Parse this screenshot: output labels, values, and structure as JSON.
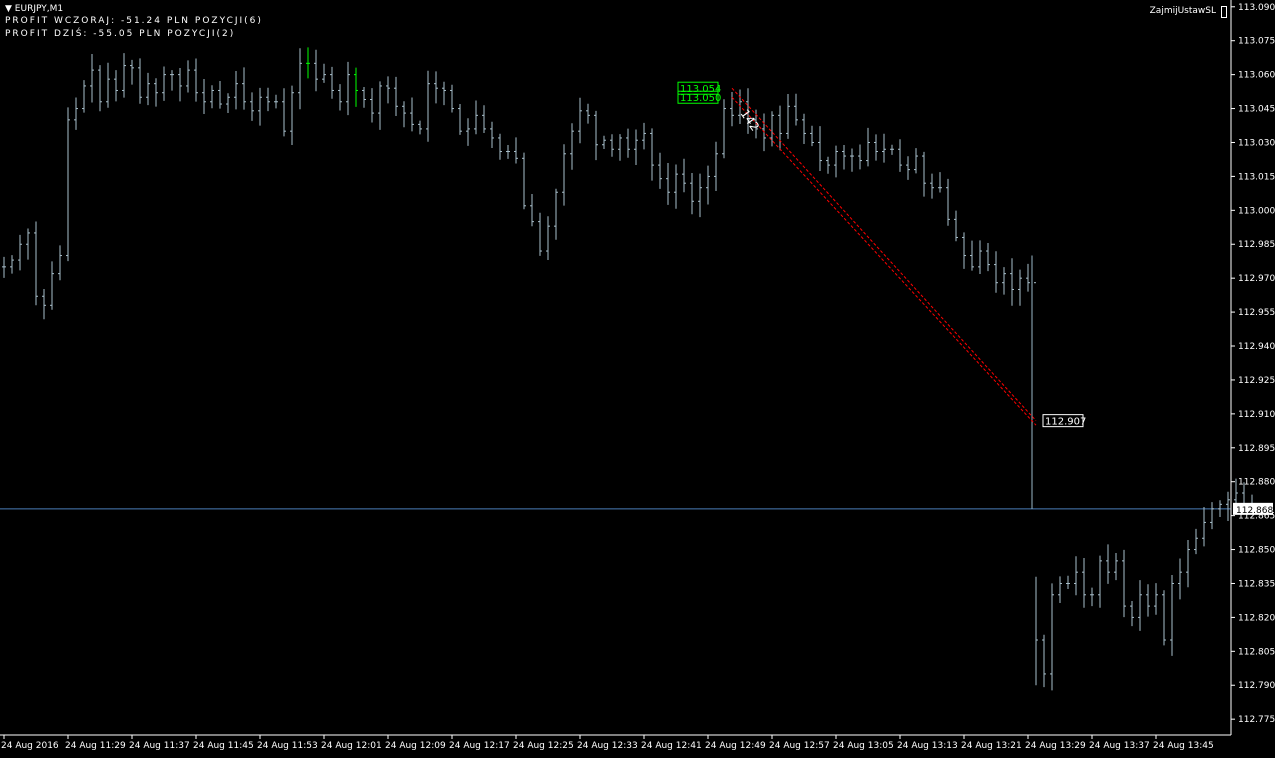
{
  "header": {
    "symbol": "EURJPY,M1",
    "line1": "PROFIT WCZORAJ: -51.24 PLN   POZYCJI(6)",
    "line2": "PROFIT DZIŚ: -55.05 PLN   POZYCJI(2)"
  },
  "expert": {
    "name": "ZajmijUstawSL"
  },
  "colors": {
    "background": "#000000",
    "bars": "#a9c0cc",
    "bull_highlight": "#00ff00",
    "axis": "#ffffff",
    "bid_line": "#4a7eb8",
    "trend_line": "#ff0000",
    "entry_label": "#00ff00",
    "drop_line": "#9ab8c8"
  },
  "chart_data": {
    "type": "ohlc",
    "symbol": "EURJPY",
    "timeframe": "M1",
    "ylim": [
      112.768,
      113.093
    ],
    "y_ticks": [
      "113.090",
      "113.075",
      "113.060",
      "113.045",
      "113.030",
      "113.015",
      "113.000",
      "112.985",
      "112.970",
      "112.955",
      "112.940",
      "112.925",
      "112.910",
      "112.895",
      "112.880",
      "112.865",
      "112.850",
      "112.835",
      "112.820",
      "112.805",
      "112.790",
      "112.775"
    ],
    "x_ticks": [
      "24 Aug 2016",
      "24 Aug 11:29",
      "24 Aug 11:37",
      "24 Aug 11:45",
      "24 Aug 11:53",
      "24 Aug 12:01",
      "24 Aug 12:09",
      "24 Aug 12:17",
      "24 Aug 12:25",
      "24 Aug 12:33",
      "24 Aug 12:41",
      "24 Aug 12:49",
      "24 Aug 12:57",
      "24 Aug 13:05",
      "24 Aug 13:13",
      "24 Aug 13:21",
      "24 Aug 13:29",
      "24 Aug 13:37",
      "24 Aug 13:45"
    ],
    "bars_per_tick": 8,
    "current_price": "112.868",
    "current_price_value": 112.868,
    "annotations": [
      {
        "type": "price_label",
        "text": "113.054",
        "value": 113.054,
        "bar": 90,
        "color": "#00ff00"
      },
      {
        "type": "price_label",
        "text": "113.050",
        "value": 113.05,
        "bar": 90,
        "color": "#00ff00"
      },
      {
        "type": "price_label",
        "text": "112.907",
        "value": 112.907,
        "bar": 130,
        "color": "#ffffff"
      },
      {
        "type": "rotated_text",
        "text": "142",
        "bar": 92,
        "value": 113.043
      }
    ],
    "trend_lines": [
      {
        "from": {
          "bar": 91,
          "value": 113.054
        },
        "to": {
          "bar": 129,
          "value": 112.907
        }
      },
      {
        "from": {
          "bar": 91,
          "value": 113.05
        },
        "to": {
          "bar": 129,
          "value": 112.905
        }
      }
    ],
    "drop_line": {
      "bar": 128.5,
      "from_value": 112.98,
      "to_value": 112.868
    },
    "closes": [
      112.975,
      112.978,
      112.985,
      112.99,
      112.962,
      112.958,
      112.972,
      112.98,
      113.04,
      113.045,
      113.055,
      113.062,
      113.048,
      113.058,
      113.053,
      113.064,
      113.063,
      113.05,
      113.056,
      113.052,
      113.06,
      113.06,
      113.055,
      113.062,
      113.052,
      113.048,
      113.053,
      113.047,
      113.05,
      113.056,
      113.048,
      113.044,
      113.05,
      113.048,
      113.048,
      113.035,
      113.052,
      113.065,
      113.065,
      113.058,
      113.06,
      113.053,
      113.048,
      113.06,
      113.053,
      113.049,
      113.043,
      113.055,
      113.054,
      113.046,
      113.043,
      113.038,
      113.036,
      113.056,
      113.054,
      113.053,
      113.045,
      113.035,
      113.036,
      113.042,
      113.036,
      113.032,
      113.026,
      113.026,
      113.023,
      113.002,
      112.995,
      112.982,
      112.993,
      113.008,
      113.025,
      113.035,
      113.044,
      113.042,
      113.029,
      113.031,
      113.027,
      113.032,
      113.027,
      113.031,
      113.034,
      113.02,
      113.014,
      113.008,
      113.016,
      113.012,
      113.004,
      113.01,
      113.015,
      113.025,
      113.045,
      113.042,
      113.048,
      113.04,
      113.036,
      113.032,
      113.042,
      113.034,
      113.046,
      113.04,
      113.034,
      113.03,
      113.022,
      113.02,
      113.026,
      113.024,
      113.024,
      113.022,
      113.03,
      113.026,
      113.027,
      113.027,
      113.02,
      113.018,
      113.024,
      113.012,
      113.01,
      113.01,
      112.996,
      112.988,
      112.98,
      112.975,
      112.982,
      112.976,
      112.968,
      112.972,
      112.965,
      112.97,
      112.968,
      112.81,
      112.795,
      112.83,
      112.835,
      112.835,
      112.84,
      112.83,
      112.83,
      112.845,
      112.84,
      112.845,
      112.825,
      112.82,
      112.83,
      112.825,
      112.83,
      112.81,
      112.835,
      112.84,
      112.85,
      112.855,
      112.862,
      112.868,
      112.87,
      112.872,
      112.875,
      112.87,
      112.868
    ]
  }
}
